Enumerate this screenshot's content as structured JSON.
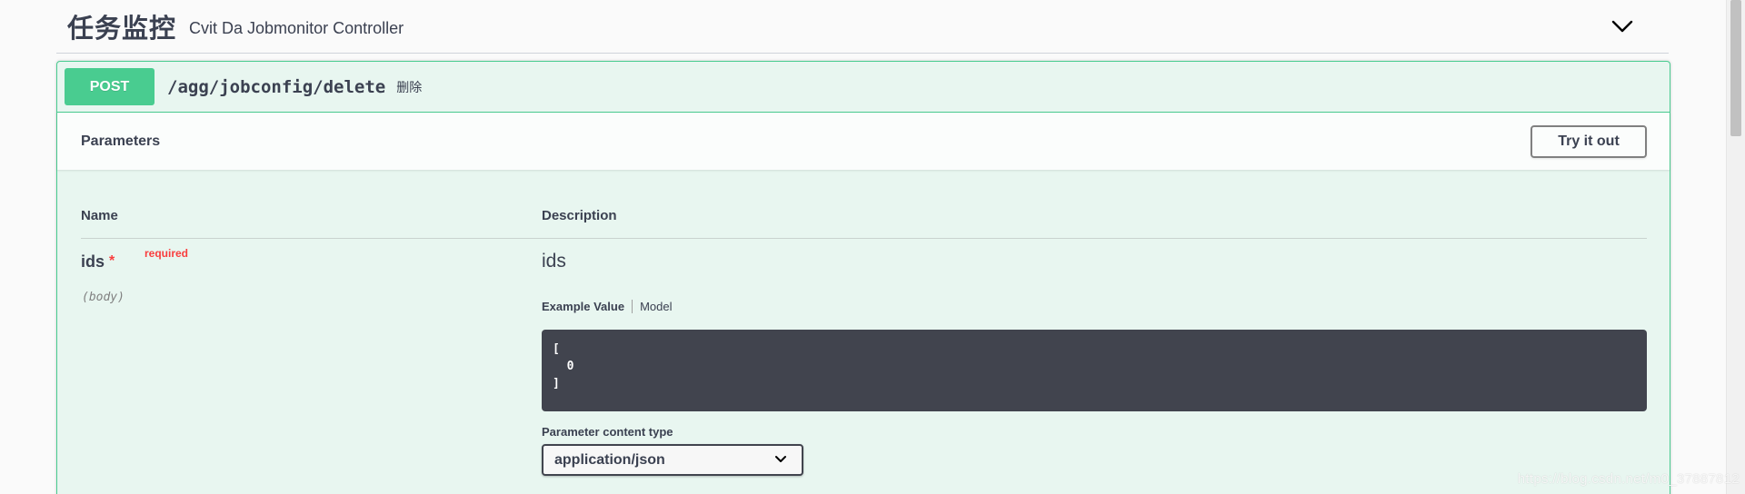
{
  "tag": {
    "title": "任务监控",
    "description": "Cvit Da Jobmonitor Controller"
  },
  "operation": {
    "method": "POST",
    "path": "/agg/jobconfig/delete",
    "summary": "删除",
    "parameters_title": "Parameters",
    "try_button": "Try it out",
    "columns": {
      "name": "Name",
      "description": "Description"
    },
    "param": {
      "name": "ids",
      "star": "*",
      "required": "required",
      "in": "(body)",
      "description": "ids",
      "tabs": {
        "example": "Example Value",
        "model": "Model"
      },
      "example_value": "[\n  0\n]",
      "content_type_label": "Parameter content type",
      "content_type_value": "application/json"
    }
  },
  "watermark": "https://blog.csdn.net/m0_37887812",
  "colors": {
    "post": "#49cc90",
    "post_bg": "#e8f6f0",
    "required": "#f93e3e",
    "code_bg": "#41444e"
  }
}
